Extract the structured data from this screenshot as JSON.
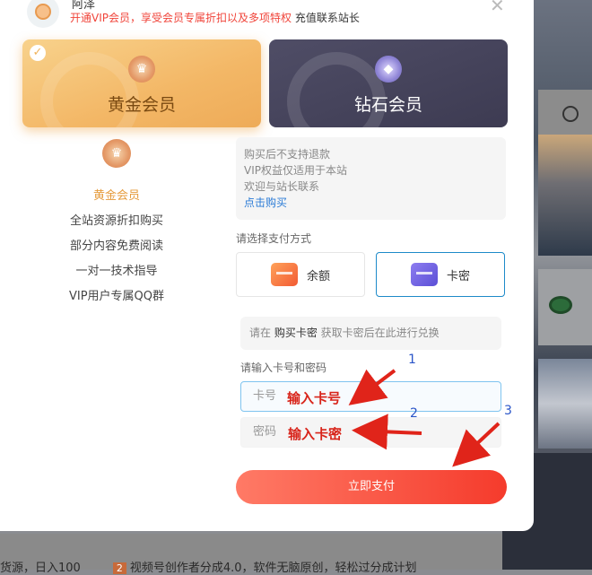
{
  "user": {
    "name": "阿泽",
    "promo_red": "开通VIP会员，享受会员专属折扣以及多项特权",
    "promo_dark": " 充值联系站长",
    "close": "✕"
  },
  "tiers": [
    {
      "label": "黄金会员",
      "icon": "crown-icon",
      "selected": true
    },
    {
      "label": "钻石会员",
      "icon": "diamond-icon",
      "selected": false
    }
  ],
  "left_panel": {
    "title": "黄金会员",
    "perks": [
      "全站资源折扣购买",
      "部分内容免费阅读",
      "一对一技术指导",
      "VIP用户专属QQ群"
    ]
  },
  "info": {
    "lines": [
      "购买后不支持退款",
      "VIP权益仅适用于本站",
      "欢迎与站长联系"
    ],
    "link": "点击购买"
  },
  "payment": {
    "label": "请选择支付方式",
    "options": [
      {
        "label": "余额",
        "icon": "wallet-icon",
        "selected": false
      },
      {
        "label": "卡密",
        "icon": "card-icon",
        "selected": true
      }
    ]
  },
  "redeem": {
    "hint_prefix": "请在 ",
    "hint_link": "购买卡密",
    "hint_suffix": " 获取卡密后在此进行兑换",
    "section_label": "请输入卡号和密码",
    "card_placeholder": "卡号",
    "password_placeholder": "密码"
  },
  "annotations": {
    "card": "输入卡号",
    "password": "输入卡密",
    "steps": [
      "1",
      "2",
      "3"
    ]
  },
  "pay_button": "立即支付",
  "background": {
    "bottom_text_1": "货源，日入100",
    "bottom_num": "2",
    "bottom_text_2": "视频号创作者分成4.0，软件无脑原创，轻松过分成计划"
  },
  "colors": {
    "accent_red": "#f53b2c",
    "gold": "#f3b766",
    "link_blue": "#2a7bd6"
  }
}
